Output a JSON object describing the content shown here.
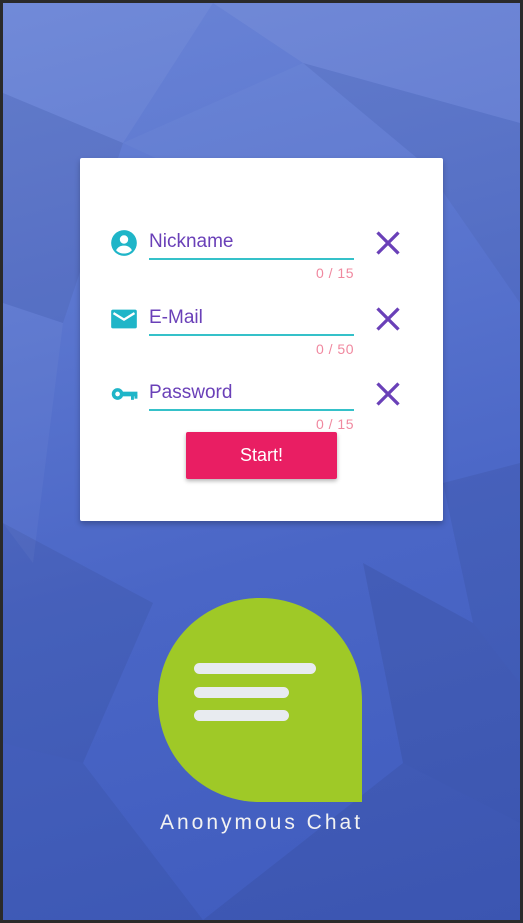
{
  "form": {
    "fields": [
      {
        "id": "nickname",
        "placeholder": "Nickname",
        "value": "",
        "counter": "0 / 15",
        "icon": "account-circle-icon"
      },
      {
        "id": "email",
        "placeholder": "E-Mail",
        "value": "",
        "counter": "0 / 50",
        "icon": "email-icon"
      },
      {
        "id": "password",
        "placeholder": "Password",
        "value": "",
        "counter": "0 / 15",
        "icon": "key-icon"
      }
    ],
    "clear_icon": "close-icon",
    "start_label": "Start!"
  },
  "brand": {
    "app_name": "Anonymous Chat",
    "logo_icon": "chat-bubble-icon"
  },
  "colors": {
    "accent": "#e91e63",
    "icon_teal": "#1fb5c8",
    "text_purple": "#6a40b8",
    "counter_pink": "#f0889f",
    "logo_green": "#9fc927"
  }
}
